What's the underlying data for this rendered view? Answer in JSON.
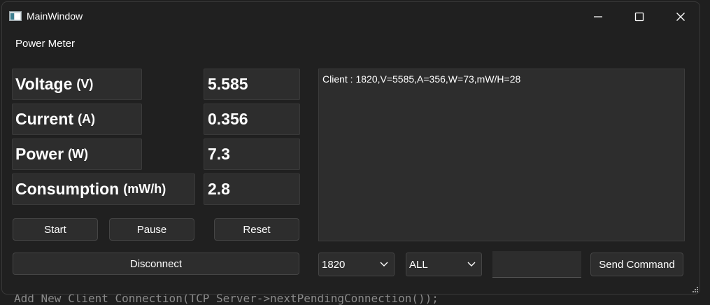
{
  "background": {
    "code_line": "Add New Client Connection(TCP Server->nextPendingConnection());"
  },
  "window": {
    "title": "MainWindow",
    "controls": {
      "minimize": "minimize-icon",
      "maximize": "maximize-icon",
      "close": "close-icon"
    }
  },
  "menubar": {
    "item": "Power Meter"
  },
  "readings": [
    {
      "label": "Voltage",
      "unit": "(V)",
      "value": "5.585"
    },
    {
      "label": "Current",
      "unit": "(A)",
      "value": "0.356"
    },
    {
      "label": "Power",
      "unit": "(W)",
      "value": "7.3"
    },
    {
      "label": "Consumption",
      "unit": "(mW/h)",
      "value": "2.8"
    }
  ],
  "buttons": {
    "start": "Start",
    "pause": "Pause",
    "reset": "Reset",
    "disconnect": "Disconnect",
    "send_command": "Send Command"
  },
  "log": {
    "text": "Client : 1820,V=5585,A=356,W=73,mW/H=28"
  },
  "controls": {
    "client_select": "1820",
    "target_select": "ALL",
    "command_input": ""
  },
  "colors": {
    "window_bg": "#202020",
    "box_bg": "#2d2d2d",
    "text": "#ffffff"
  }
}
